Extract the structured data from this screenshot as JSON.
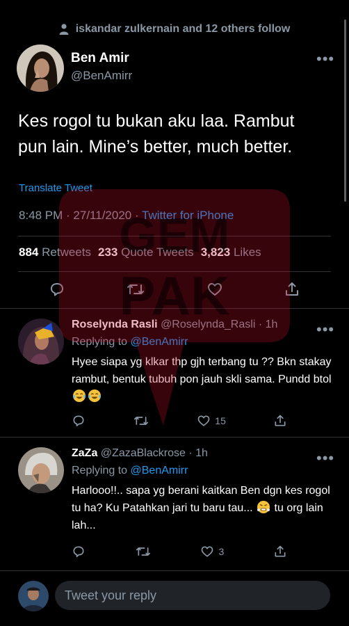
{
  "social_context": {
    "text": "iskandar zulkernain and 12 others follow"
  },
  "tweet": {
    "author_name": "Ben Amir",
    "author_handle": "@BenAmirr",
    "text": "Kes rogol tu bukan aku laa. Rambut pun lain. Mine’s better, much better.",
    "translate_label": "Translate Tweet",
    "timestamp": "8:48 PM · 27/11/2020 ·",
    "source": "Twitter for iPhone",
    "retweets_count": "884",
    "retweets_label": "Retweets",
    "quote_count": "233",
    "quote_label": "Quote Tweets",
    "likes_count": "3,823",
    "likes_label": "Likes"
  },
  "replies": [
    {
      "name": "Roselynda Rasli",
      "handle": "@Roselynda_Rasli",
      "time": "· 1h",
      "replying_prefix": "Replying to",
      "replying_handle": "@BenAmirr",
      "text_before_emoji": "Hyee siapa yg klkar thp gjh terbang tu ?? Bkn stakay rambut, bentuk tubuh pon jauh skli sama. Pundd btol",
      "text_after_emoji": "",
      "likes": "15"
    },
    {
      "name": "ZaZa",
      "handle": "@ZazaBlackrose",
      "time": "· 1h",
      "replying_prefix": "Replying to",
      "replying_handle": "@BenAmirr",
      "text_before_emoji": "Harlooo!!.. sapa yg berani kaitkan Ben dgn kes rogol tu ha? Ku Patahkan jari tu baru tau...",
      "text_after_emoji": " tu org lain lah...",
      "likes": "3"
    }
  ],
  "composer": {
    "placeholder": "Tweet your reply"
  },
  "watermark": {
    "text_top": "GEM",
    "text_bottom": "PAK",
    "color": "#c8102e"
  },
  "colors": {
    "accent": "#1d9bf0",
    "background": "#000000",
    "secondary_text": "#8b98a5",
    "divider": "#2f3336"
  }
}
